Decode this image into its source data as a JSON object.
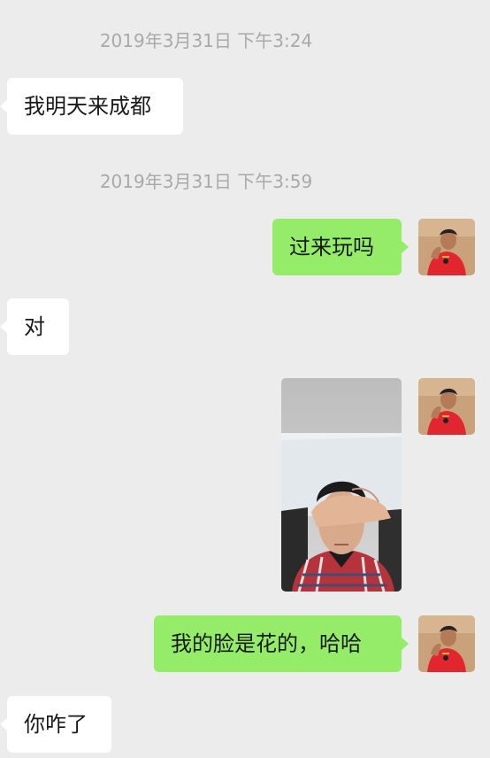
{
  "messages": {
    "timestamp_1": "2019年3月31日 下午3:24",
    "msg_1": "我明天来成都",
    "timestamp_2": "2019年3月31日 下午3:59",
    "msg_2": "过来玩吗",
    "msg_3": "对",
    "msg_5": "我的脸是花的，哈哈",
    "msg_6": "你咋了"
  },
  "colors": {
    "background": "#ececec",
    "incoming_bubble": "#ffffff",
    "outgoing_bubble": "#95ec69",
    "timestamp_text": "#a9a9a9",
    "message_text": "#191919"
  },
  "icons": {
    "user_avatar": "avatar-icon",
    "shared_photo": "photo"
  }
}
